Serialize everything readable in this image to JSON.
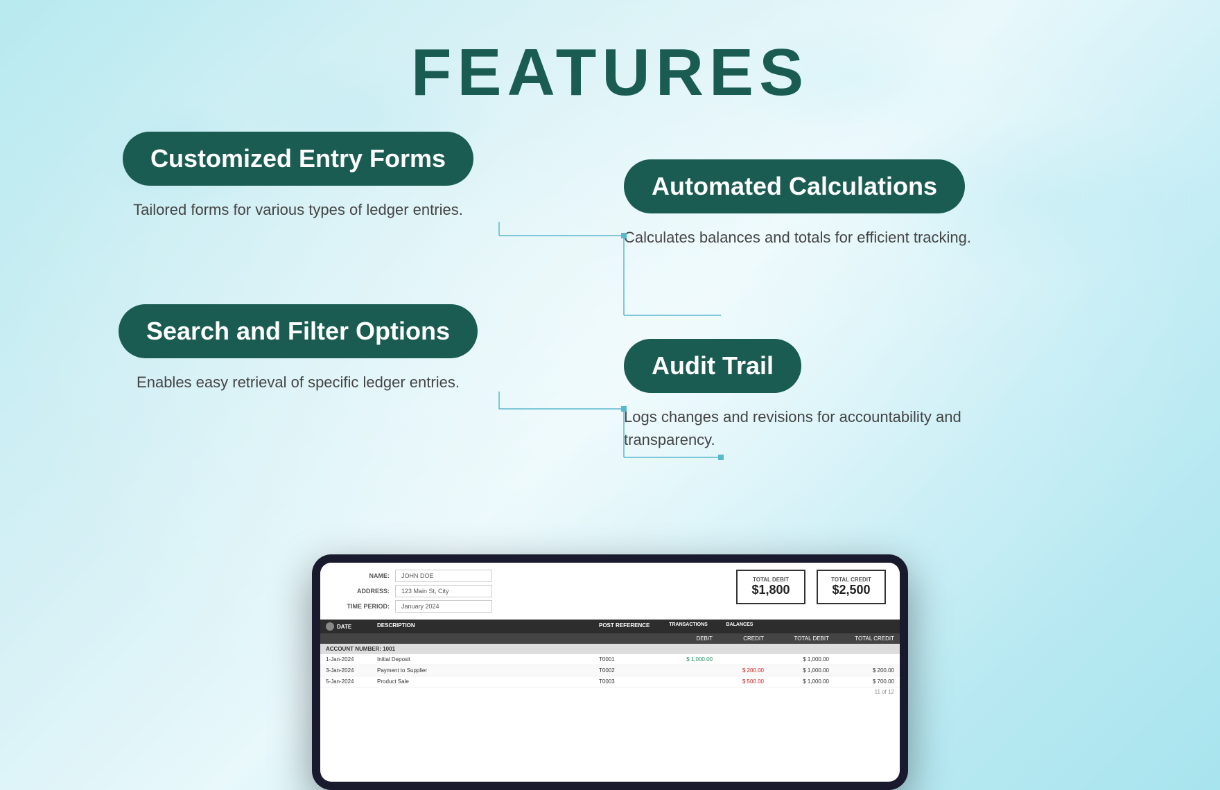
{
  "page": {
    "title": "FEATURES",
    "background_color": "#b8eaf0"
  },
  "features": {
    "left": [
      {
        "id": "customized-entry-forms",
        "label": "Customized Entry Forms",
        "description": "Tailored forms for various types of ledger entries."
      },
      {
        "id": "search-filter-options",
        "label": "Search and Filter Options",
        "description": "Enables easy retrieval of specific ledger entries."
      }
    ],
    "right": [
      {
        "id": "automated-calculations",
        "label": "Automated Calculations",
        "description": "Calculates balances and totals for efficient tracking."
      },
      {
        "id": "audit-trail",
        "label": "Audit Trail",
        "description": "Logs changes and revisions for accountability and transparency."
      }
    ]
  },
  "tablet": {
    "form_fields": [
      {
        "label": "NAME:",
        "value": "JOHN DOE"
      },
      {
        "label": "ADDRESS:",
        "value": "123 Main St, City"
      },
      {
        "label": "TIME PERIOD:",
        "value": "January 2024"
      }
    ],
    "totals": [
      {
        "label": "TOTAL DEBIT",
        "value": "$1,800"
      },
      {
        "label": "TOTAL CREDIT",
        "value": "$2,500"
      }
    ],
    "page_indicator": "11 of 12",
    "table": {
      "headers": [
        "DATE",
        "DESCRIPTION",
        "POST REFERENCE",
        "DEBIT",
        "CREDIT",
        "TOTAL DEBIT",
        "TOTAL CREDIT"
      ],
      "account_number": "ACCOUNT NUMBER: 1001",
      "rows": [
        {
          "date": "1-Jan-2024",
          "description": "Initial Deposit",
          "ref": "T0001",
          "debit": "1,000.00",
          "credit": "",
          "total_debit": "1,000.00",
          "total_credit": ""
        },
        {
          "date": "3-Jan-2024",
          "description": "Payment to Supplier",
          "ref": "T0002",
          "debit": "",
          "credit": "200.00",
          "total_debit": "1,000.00",
          "total_credit": "200.00"
        },
        {
          "date": "5-Jan-2024",
          "description": "Product Sale",
          "ref": "T0003",
          "debit": "",
          "credit": "500.00",
          "total_debit": "1,000.00",
          "total_credit": "700.00"
        }
      ]
    }
  }
}
